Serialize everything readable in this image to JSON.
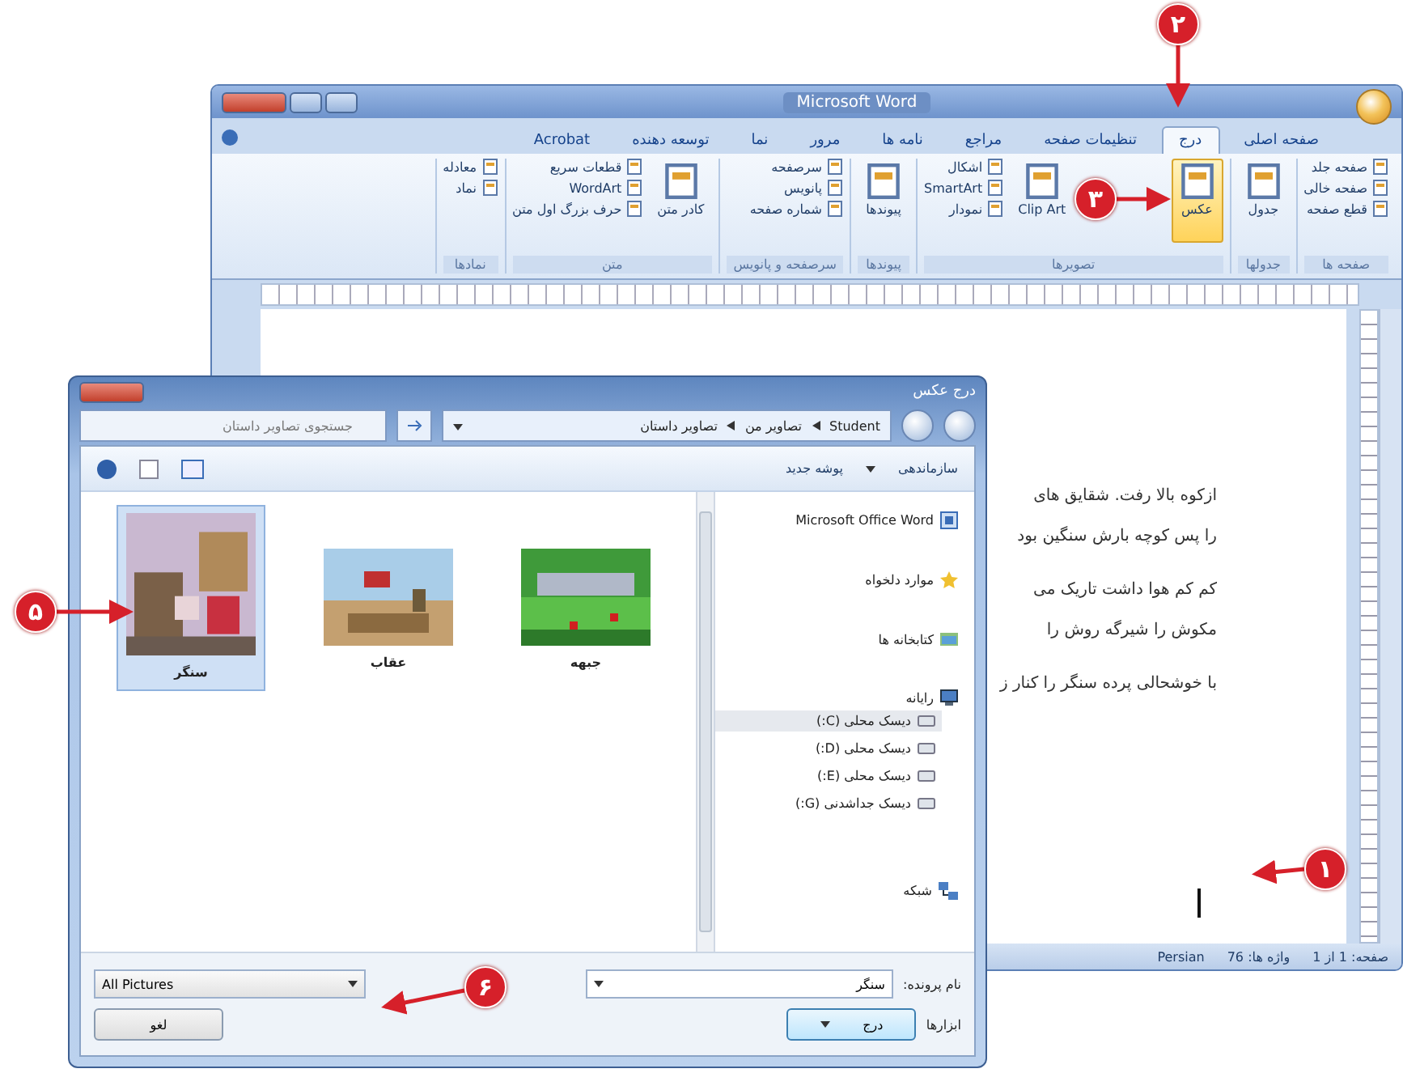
{
  "word_window": {
    "title": "Microsoft Word",
    "tabs": [
      {
        "label": "صفحه اصلی",
        "selected": false
      },
      {
        "label": "درج",
        "selected": true
      },
      {
        "label": "تنظیمات صفحه",
        "selected": false
      },
      {
        "label": "مراجع",
        "selected": false
      },
      {
        "label": "نامه ها",
        "selected": false
      },
      {
        "label": "مرور",
        "selected": false
      },
      {
        "label": "نما",
        "selected": false
      },
      {
        "label": "توسعه دهنده",
        "selected": false
      },
      {
        "label": "Acrobat",
        "selected": false
      }
    ],
    "ribbon_groups": [
      {
        "title": "صفحه ها",
        "items": [
          {
            "label": "صفحه جلد",
            "kind": "small",
            "highlighted": false
          },
          {
            "label": "صفحه خالی",
            "kind": "small",
            "highlighted": false
          },
          {
            "label": "قطع صفحه",
            "kind": "small",
            "highlighted": false
          }
        ]
      },
      {
        "title": "جدولها",
        "items": [
          {
            "label": "جدول",
            "kind": "large",
            "highlighted": false
          }
        ]
      },
      {
        "title": "تصویرها",
        "items": [
          {
            "label": "عکس",
            "kind": "large",
            "highlighted": true
          },
          {
            "label": "Clip Art",
            "kind": "large",
            "highlighted": false
          },
          {
            "label": "اشکال",
            "kind": "small",
            "highlighted": false
          },
          {
            "label": "SmartArt",
            "kind": "small",
            "highlighted": false
          },
          {
            "label": "نمودار",
            "kind": "small",
            "highlighted": false
          }
        ]
      },
      {
        "title": "پیوندها",
        "items": [
          {
            "label": "پیوندها",
            "kind": "large",
            "highlighted": false
          }
        ]
      },
      {
        "title": "سرصفحه و پانویس",
        "items": [
          {
            "label": "سرصفحه",
            "kind": "small",
            "highlighted": false
          },
          {
            "label": "پانویس",
            "kind": "small",
            "highlighted": false
          },
          {
            "label": "شماره صفحه",
            "kind": "small",
            "highlighted": false
          }
        ]
      },
      {
        "title": "متن",
        "items": [
          {
            "label": "کادر متن",
            "kind": "large",
            "highlighted": false
          },
          {
            "label": "قطعات سریع",
            "kind": "small",
            "highlighted": false
          },
          {
            "label": "WordArt",
            "kind": "small",
            "highlighted": false
          },
          {
            "label": "حرف بزرگ اول متن",
            "kind": "small",
            "highlighted": false
          }
        ]
      },
      {
        "title": "نمادها",
        "items": [
          {
            "label": "معادله",
            "kind": "small",
            "highlighted": false
          },
          {
            "label": "نماد",
            "kind": "small",
            "highlighted": false
          }
        ]
      }
    ],
    "document_lines": [
      "ازکوه بالا رفت. شقایق های",
      "را پس کوچه بارش سنگین بود",
      "کم کم هوا داشت تاریک می",
      "مکوش را شیرگه روش را",
      "با خوشحالی پرده سنگر را کنار ز"
    ],
    "status_bar": {
      "page": "صفحه: 1 از 1",
      "words": "واژه ها: 76",
      "language": "Persian"
    }
  },
  "dialog": {
    "title": "درج عکس",
    "breadcrumb": [
      "Student",
      "تصاویر من",
      "تصاویر داستان"
    ],
    "search_placeholder": "جستجوی تصاویر داستان",
    "toolbar": [
      "سازماندهی",
      "پوشه جدید"
    ],
    "nav": [
      {
        "label": "Microsoft Office Word",
        "kind": "app",
        "selected": false
      },
      {
        "label": "موارد دلخواه",
        "kind": "favorites",
        "selected": false
      },
      {
        "label": "کتابخانه ها",
        "kind": "libraries",
        "selected": false
      },
      {
        "label": "رایانه",
        "kind": "computer",
        "selected": false
      },
      {
        "label": "دیسک محلی (C:)",
        "kind": "drive",
        "selected": true
      },
      {
        "label": "دیسک محلی (D:)",
        "kind": "drive",
        "selected": false
      },
      {
        "label": "دیسک محلی (E:)",
        "kind": "drive",
        "selected": false
      },
      {
        "label": "دیسک جداشدنی (G:)",
        "kind": "drive",
        "selected": false
      },
      {
        "label": "شبکه",
        "kind": "network",
        "selected": false
      }
    ],
    "files": [
      {
        "name": "جبهه",
        "selected": false
      },
      {
        "name": "عقاب",
        "selected": false
      },
      {
        "name": "سنگر",
        "selected": true
      }
    ],
    "file_name_label": "نام پرونده:",
    "file_name": "سنگر",
    "file_type": "All Pictures",
    "tools": "ابزارها",
    "buttons": [
      {
        "label": "درج",
        "kind": "primary"
      },
      {
        "label": "لغو",
        "kind": "plain"
      }
    ]
  },
  "callouts": [
    "۱",
    "۲",
    "۳",
    "۵",
    "۶"
  ]
}
